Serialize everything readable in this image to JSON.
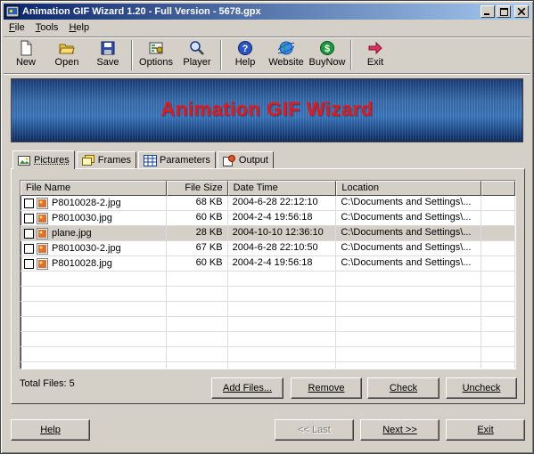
{
  "window": {
    "title": "Animation GIF Wizard 1.20 - Full Version - 5678.gpx"
  },
  "menu": [
    {
      "label": "File",
      "key": "F",
      "rest": "ile"
    },
    {
      "label": "Tools",
      "key": "T",
      "rest": "ools"
    },
    {
      "label": "Help",
      "key": "H",
      "rest": "elp"
    }
  ],
  "toolbar": {
    "new": "New",
    "open": "Open",
    "save": "Save",
    "options": "Options",
    "player": "Player",
    "help": "Help",
    "website": "Website",
    "buynow": "BuyNow",
    "exit": "Exit"
  },
  "banner": {
    "text": "Animation GIF Wizard"
  },
  "tabs": [
    "Pictures",
    "Frames",
    "Parameters",
    "Output"
  ],
  "list": {
    "columns": [
      "File Name",
      "File Size",
      "Date Time",
      "Location"
    ],
    "rows": [
      {
        "name": "P8010028-2.jpg",
        "size": "68 KB",
        "date": "2004-6-28 22:12:10",
        "location": "C:\\Documents and Settings\\..."
      },
      {
        "name": "P8010030.jpg",
        "size": "60 KB",
        "date": "2004-2-4 19:56:18",
        "location": "C:\\Documents and Settings\\..."
      },
      {
        "name": "plane.jpg",
        "size": "28 KB",
        "date": "2004-10-10 12:36:10",
        "location": "C:\\Documents and Settings\\..."
      },
      {
        "name": "P8010030-2.jpg",
        "size": "67 KB",
        "date": "2004-6-28 22:10:50",
        "location": "C:\\Documents and Settings\\..."
      },
      {
        "name": "P8010028.jpg",
        "size": "60 KB",
        "date": "2004-2-4 19:56:18",
        "location": "C:\\Documents and Settings\\..."
      }
    ],
    "selected_row": 2
  },
  "panel": {
    "total_files": "Total Files: 5",
    "add_files": "Add Files...",
    "remove": "Remove",
    "check": "Check",
    "uncheck": "Uncheck"
  },
  "nav": {
    "help": "Help",
    "last": "<< Last",
    "next": "Next >>",
    "exit": "Exit"
  },
  "colors": {
    "title_start": "#0a246a",
    "title_end": "#a6caf0",
    "banner_text": "#e81818",
    "face": "#d4d0c8"
  }
}
